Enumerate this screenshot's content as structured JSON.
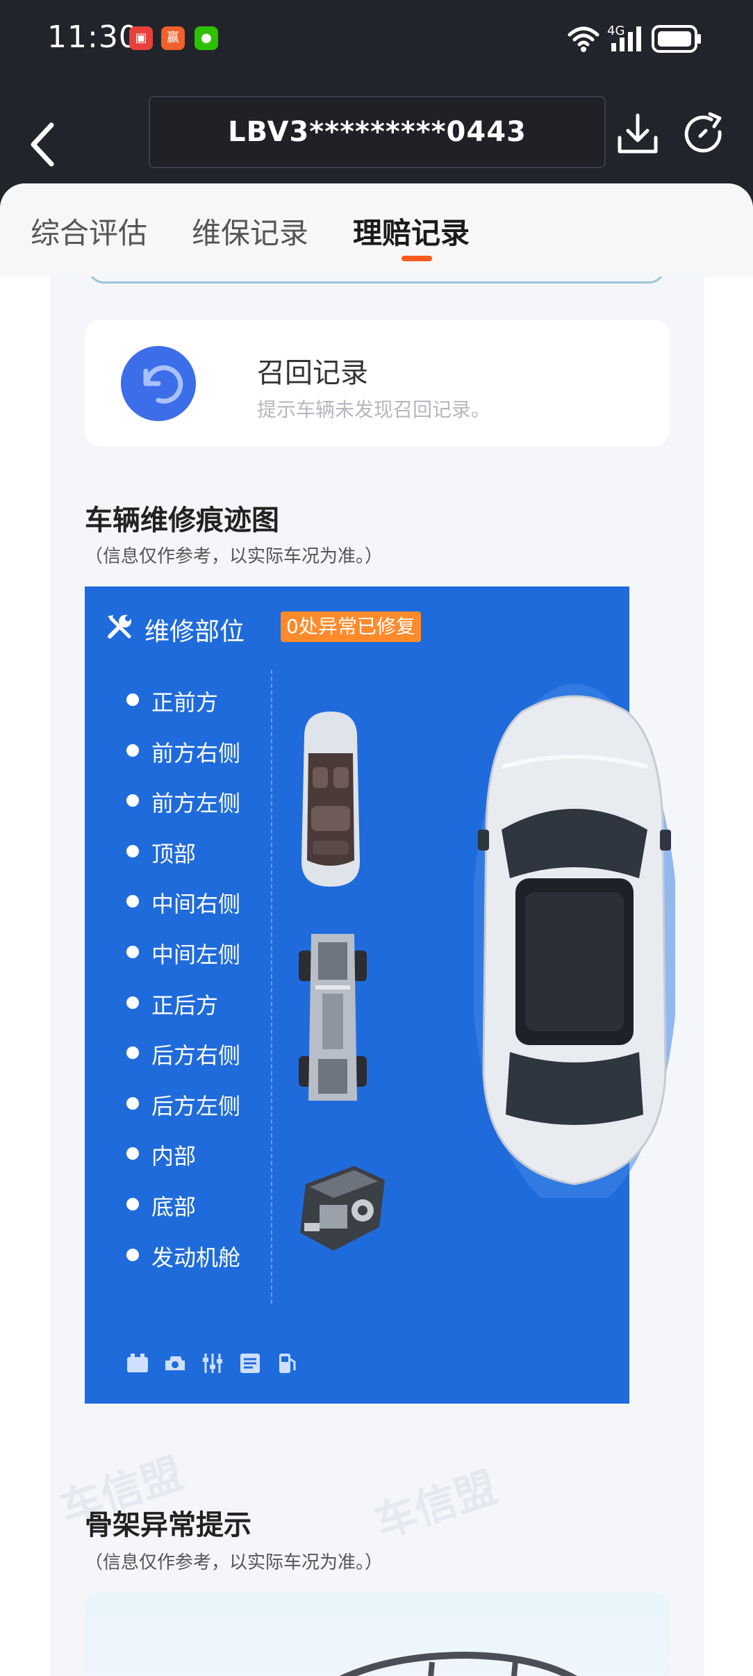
{
  "status": {
    "time": "11:30",
    "apps": [
      {
        "name": "huawei-store-icon",
        "color": "#e8413c",
        "glyph": "▣"
      },
      {
        "name": "game-app-icon",
        "color": "#f0602a",
        "glyph": "赢"
      },
      {
        "name": "wechat-icon",
        "color": "#2dc100",
        "glyph": "●"
      }
    ],
    "network": "4G"
  },
  "header": {
    "vin": "LBV3*********0443"
  },
  "tabs": [
    {
      "label": "综合评估",
      "active": false
    },
    {
      "label": "维保记录",
      "active": false
    },
    {
      "label": "理赔记录",
      "active": true
    }
  ],
  "recall": {
    "title": "召回记录",
    "subtitle": "提示车辆未发现召回记录。"
  },
  "repair_map": {
    "title": "车辆维修痕迹图",
    "note": "（信息仅作参考，以实际车况为准。）",
    "panel_title": "维修部位",
    "badge": "0处异常已修复",
    "parts": [
      "正前方",
      "前方右侧",
      "前方左侧",
      "顶部",
      "中间右侧",
      "中间左侧",
      "正后方",
      "后方右侧",
      "后方左侧",
      "内部",
      "底部",
      "发动机舱"
    ],
    "accent": "#1f6bdb",
    "badge_color": "#ff8a2a"
  },
  "frame": {
    "title": "骨架异常提示",
    "note": "（信息仅作参考，以实际车况为准。）"
  },
  "watermark": "车信盟"
}
